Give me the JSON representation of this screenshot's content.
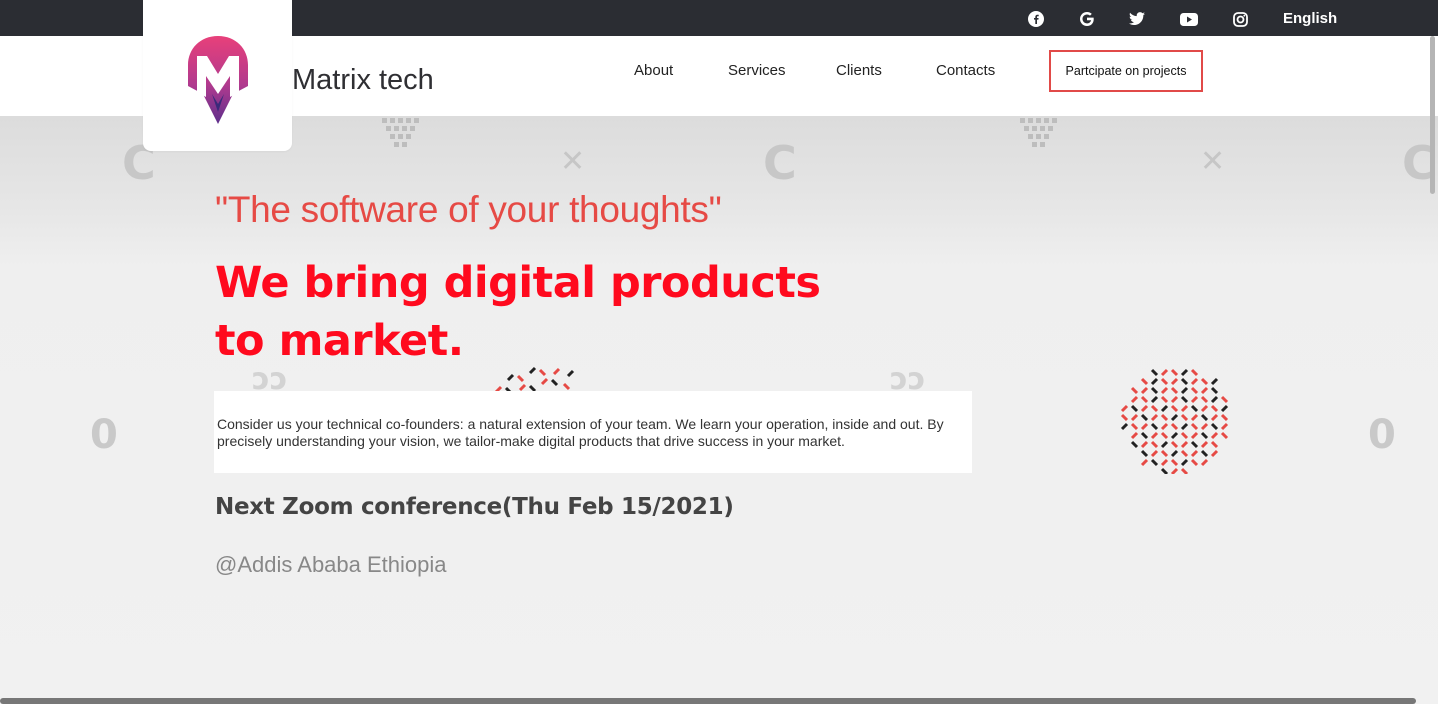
{
  "topbar": {
    "social_icons": [
      "facebook-icon",
      "google-icon",
      "twitter-icon",
      "youtube-icon",
      "instagram-icon"
    ],
    "language": "English"
  },
  "header": {
    "brand": "Matrix tech",
    "nav": [
      "About",
      "Services",
      "Clients",
      "Contacts"
    ],
    "cta": "Partcipate on projects"
  },
  "hero": {
    "quote": "\"The software of your thoughts\"",
    "headline_line1": "We bring digital products",
    "headline_line2": "to market.",
    "description": "Consider us your technical co-founders: a natural extension of your team. We learn your operation, inside and out. By precisely understanding your vision, we tailor-make digital products that drive success in your market.",
    "event": "Next Zoom conference(Thu Feb 15/2021)",
    "location": "@Addis Ababa Ethiopia"
  },
  "colors": {
    "topbar": "#2b2d33",
    "accent": "#e64a45",
    "headline": "#ff0a1e",
    "cta_border": "#e14a48"
  }
}
